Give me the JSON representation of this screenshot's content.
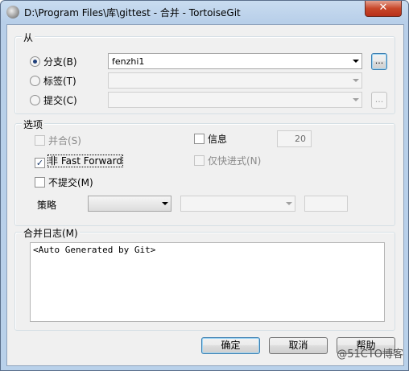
{
  "window": {
    "title": "D:\\Program Files\\库\\gittest - 合并 - TortoiseGit",
    "close_glyph": "✕"
  },
  "from": {
    "label": "从",
    "branch": {
      "label": "分支(B)",
      "value": "fenzhi1",
      "selected": true
    },
    "tag": {
      "label": "标签(T)",
      "value": ""
    },
    "commit": {
      "label": "提交(C)",
      "value": ""
    },
    "browse_label": "..."
  },
  "options": {
    "label": "选项",
    "squash": {
      "label": "并合(S)",
      "checked": false,
      "enabled": false
    },
    "no_fast_forward": {
      "label": "非 Fast Forward",
      "checked": true
    },
    "no_commit": {
      "label": "不提交(M)",
      "checked": false
    },
    "message": {
      "label": "信息",
      "checked": false
    },
    "log_count": "20",
    "ff_only": {
      "label": "仅快进式(N)",
      "checked": false,
      "enabled": false
    },
    "strategy": {
      "label": "策略",
      "value": "",
      "option_value": "",
      "extra": ""
    }
  },
  "merge_log": {
    "label": "合并日志(M)",
    "text": "<Auto Generated by Git>"
  },
  "buttons": {
    "ok": "确定",
    "cancel": "取消",
    "help": "帮助"
  },
  "watermark": "@51CTO博客",
  "colors": {
    "title_bar": "#b9d1ea",
    "dialog_bg": "#f0f0f0",
    "close_button": "#c8472a"
  }
}
